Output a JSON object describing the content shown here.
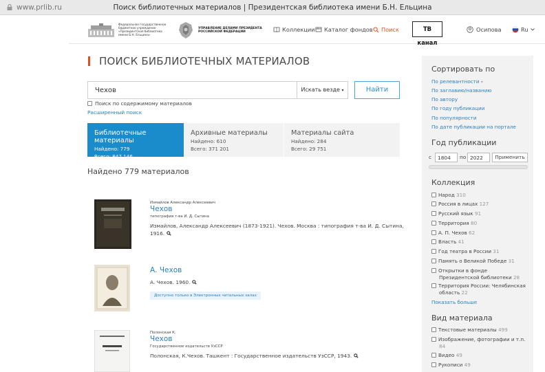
{
  "browser": {
    "url": "www.prlib.ru",
    "title": "Поиск библиотечных материалов | Президентская библиотека имени Б.Н. Ельцина"
  },
  "header": {
    "logo1_text": "Федеральное государственное\nбюджетное учреждение\n«Президентская библиотека\nимени Б.Н. Ельцина»",
    "logo2_text": "УПРАВЛЕНИЕ ДЕЛАМИ ПРЕЗИДЕНТА\nРОССИЙСКОЙ ФЕДЕРАЦИИ",
    "nav": {
      "collections": "Коллекции",
      "catalog": "Каталог фондов",
      "search": "Поиск"
    },
    "tv": "ТВ канал",
    "user": "Осипова",
    "lang": "Ru"
  },
  "page_title": "ПОИСК БИБЛИОТЕЧНЫХ МАТЕРИАЛОВ",
  "search": {
    "query": "Чехов",
    "scope": "Искать везде",
    "button": "Найти",
    "content_option": "Поиск по содержимому материалов",
    "advanced": "Расширенный поиск"
  },
  "tabs": [
    {
      "name": "Библиотечные материалы",
      "found": "Найдено: 779",
      "total": "Всего: 847 146"
    },
    {
      "name": "Архивные материалы",
      "found": "Найдено: 610",
      "total": "Всего: 371 201"
    },
    {
      "name": "Материалы сайта",
      "found": "Найдено: 284",
      "total": "Всего: 29 751"
    }
  ],
  "found_text": "Найдено 779 материалов",
  "results": [
    {
      "author": "Измайлов Александр Алексеевич",
      "title": "Чехов",
      "publisher": "типография т-ва И. Д. Сытина",
      "citation1": "Измайлов, Александр Алексеевич (1873-1921). Чехов. Москва : типография т-ва И. Д. Сытина,",
      "citation2": "1916."
    },
    {
      "title": "А. Чехов",
      "citation1": "А. Чехов. 1960.",
      "badge": "Доступно только в Электронных читальных залах"
    },
    {
      "author": "Полонская К.",
      "title": "Чехов",
      "publisher": "Государственное издательств УзССР",
      "citation1": "Полонская, К.Чехов. Ташкент : Государственное издательств УзССР, 1943."
    }
  ],
  "sidebar": {
    "sort_heading": "Сортировать по",
    "sort_options": [
      "По релевантности",
      "По заглавию/названию",
      "По автору",
      "По году публикации",
      "По популярности",
      "По дате публикации на портале"
    ],
    "year_heading": "Год публикации",
    "year_prefix": "с",
    "year_from": "1804",
    "year_mid": "по",
    "year_to": "2022",
    "apply": "Применить",
    "collection_heading": "Коллекция",
    "collections": [
      {
        "label": "Народ",
        "count": "310"
      },
      {
        "label": "Россия в лицах",
        "count": "127"
      },
      {
        "label": "Русский язык",
        "count": "91"
      },
      {
        "label": "Территория",
        "count": "80"
      },
      {
        "label": "А. П. Чехов",
        "count": "62"
      },
      {
        "label": "Власть",
        "count": "41"
      },
      {
        "label": "Год театра в России",
        "count": "31"
      },
      {
        "label": "Память о Великой Победе",
        "count": "31"
      },
      {
        "label": "Открытки в фонде",
        "label2": "Президентской библиотеки",
        "count": "28"
      },
      {
        "label": "Территория России: Челябинская",
        "label2": "область",
        "count": "22"
      }
    ],
    "show_more": "Показать больше",
    "material_heading": "Вид материала",
    "materials": [
      {
        "label": "Текстовые материалы",
        "count": "499"
      },
      {
        "label": "Изображение, фотографии и т.п.",
        "count": "84"
      },
      {
        "label": "Видео",
        "count": "49"
      },
      {
        "label": "Рукописи",
        "count": "49"
      }
    ]
  }
}
